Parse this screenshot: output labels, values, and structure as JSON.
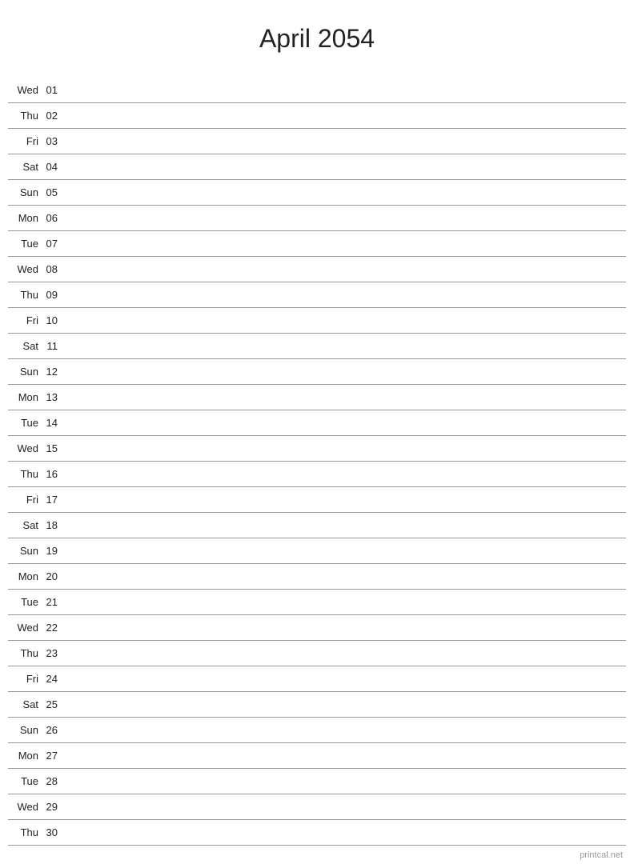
{
  "title": "April 2054",
  "watermark": "printcal.net",
  "days": [
    {
      "dow": "Wed",
      "num": "01"
    },
    {
      "dow": "Thu",
      "num": "02"
    },
    {
      "dow": "Fri",
      "num": "03"
    },
    {
      "dow": "Sat",
      "num": "04"
    },
    {
      "dow": "Sun",
      "num": "05"
    },
    {
      "dow": "Mon",
      "num": "06"
    },
    {
      "dow": "Tue",
      "num": "07"
    },
    {
      "dow": "Wed",
      "num": "08"
    },
    {
      "dow": "Thu",
      "num": "09"
    },
    {
      "dow": "Fri",
      "num": "10"
    },
    {
      "dow": "Sat",
      "num": "11"
    },
    {
      "dow": "Sun",
      "num": "12"
    },
    {
      "dow": "Mon",
      "num": "13"
    },
    {
      "dow": "Tue",
      "num": "14"
    },
    {
      "dow": "Wed",
      "num": "15"
    },
    {
      "dow": "Thu",
      "num": "16"
    },
    {
      "dow": "Fri",
      "num": "17"
    },
    {
      "dow": "Sat",
      "num": "18"
    },
    {
      "dow": "Sun",
      "num": "19"
    },
    {
      "dow": "Mon",
      "num": "20"
    },
    {
      "dow": "Tue",
      "num": "21"
    },
    {
      "dow": "Wed",
      "num": "22"
    },
    {
      "dow": "Thu",
      "num": "23"
    },
    {
      "dow": "Fri",
      "num": "24"
    },
    {
      "dow": "Sat",
      "num": "25"
    },
    {
      "dow": "Sun",
      "num": "26"
    },
    {
      "dow": "Mon",
      "num": "27"
    },
    {
      "dow": "Tue",
      "num": "28"
    },
    {
      "dow": "Wed",
      "num": "29"
    },
    {
      "dow": "Thu",
      "num": "30"
    }
  ]
}
